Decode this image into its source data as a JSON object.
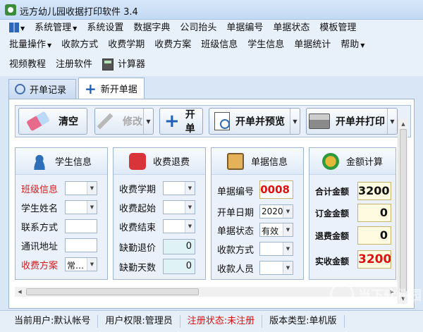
{
  "window": {
    "title": "远方幼儿园收据打印软件 3.4"
  },
  "menu": {
    "row1": [
      {
        "label": "",
        "icon": "grid-icon",
        "dropdown": true
      },
      {
        "label": "系统管理",
        "dropdown": true
      },
      {
        "label": "系统设置"
      },
      {
        "label": "数据字典"
      },
      {
        "label": "公司抬头"
      },
      {
        "label": "单据编号"
      },
      {
        "label": "单据状态"
      },
      {
        "label": "模板管理"
      }
    ],
    "row2": [
      {
        "label": "批量操作",
        "dropdown": true
      },
      {
        "label": "收款方式"
      },
      {
        "label": "收费学期"
      },
      {
        "label": "收费方案"
      },
      {
        "label": "班级信息"
      },
      {
        "label": "学生信息"
      },
      {
        "label": "单据统计"
      },
      {
        "label": "帮助",
        "dropdown": true
      }
    ],
    "row3": [
      {
        "label": "视频教程"
      },
      {
        "label": "注册软件"
      },
      {
        "label": "计算器",
        "icon": "calculator-icon"
      }
    ]
  },
  "tabs": {
    "records": "开单记录",
    "new": "新开单据"
  },
  "toolbar": {
    "clear": "清空",
    "modify": "修改",
    "open": "开单",
    "open_preview": "开单并预览",
    "open_print": "开单并打印"
  },
  "student": {
    "title": "学生信息",
    "class_label": "班级信息",
    "name_label": "学生姓名",
    "contact_label": "联系方式",
    "address_label": "通讯地址",
    "plan_label": "收费方案",
    "plan_value": "常…"
  },
  "fees": {
    "title": "收费退费",
    "term_label": "收费学期",
    "start_label": "收费起始",
    "end_label": "收费结束",
    "absence_refund_label": "缺勤退价",
    "absence_refund_value": "0",
    "absence_days_label": "缺勤天数",
    "absence_days_value": "0"
  },
  "receipt": {
    "title": "单据信息",
    "number_label": "单据编号",
    "number_value": "0008",
    "date_label": "开单日期",
    "date_value": "2020",
    "status_label": "单据状态",
    "status_value": "有效",
    "method_label": "收款方式",
    "payee_label": "收款人员"
  },
  "amount": {
    "title": "金额计算",
    "total_label": "合计金额",
    "total_value": "3200",
    "deposit_label": "订金金额",
    "deposit_value": "0",
    "refund_label": "退费金额",
    "refund_value": "0",
    "received_label": "实收金额",
    "received_value": "3200"
  },
  "status": {
    "user": "当前用户:默认帐号",
    "permission": "用户权限:管理员",
    "registration": "注册状态:未注册",
    "version": "版本类型:单机版"
  },
  "watermark": {
    "text": "当下软件园",
    "sub": "www.downxia.com"
  },
  "colors": {
    "accent": "#1f5fb5",
    "red_label": "#d21e1e",
    "amount_red": "#e01010"
  }
}
